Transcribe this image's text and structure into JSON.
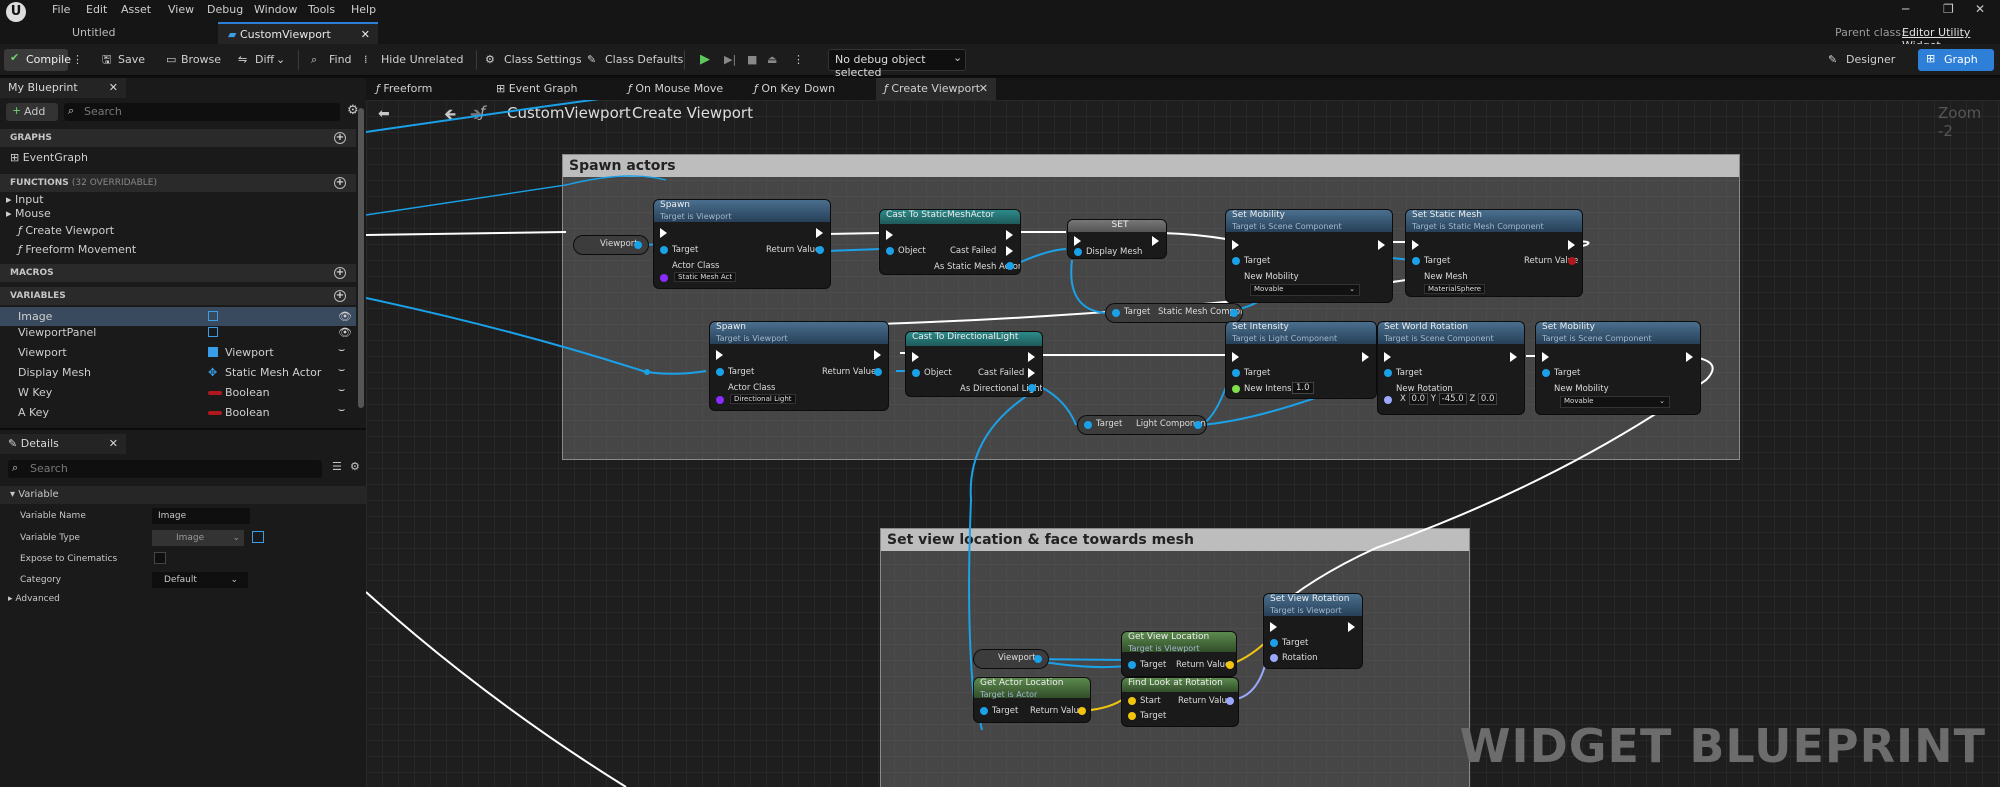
{
  "menubar": {
    "items": [
      "File",
      "Edit",
      "Asset",
      "View",
      "Debug",
      "Window",
      "Tools",
      "Help"
    ]
  },
  "doc_tabs": {
    "untitled": "Untitled",
    "custom": "CustomViewport"
  },
  "parent_class": {
    "label": "Parent class:",
    "value": "Editor Utility Widget"
  },
  "toolbar": {
    "compile": "Compile",
    "save": "Save",
    "browse": "Browse",
    "diff": "Diff",
    "find": "Find",
    "hide_unrelated": "Hide Unrelated",
    "class_settings": "Class Settings",
    "class_defaults": "Class Defaults",
    "debug_object": "No debug object selected",
    "designer": "Designer",
    "graph": "Graph"
  },
  "my_blueprint": {
    "tab": "My Blueprint",
    "add": "Add",
    "search_placeholder": "Search",
    "graphs_header": "GRAPHS",
    "event_graph": "EventGraph",
    "functions_header": "FUNCTIONS",
    "functions_count": "(32 OVERRIDABLE)",
    "functions": [
      "Input",
      "Mouse",
      "Create Viewport",
      "Freeform Movement"
    ],
    "macros_header": "MACROS",
    "variables_header": "VARIABLES",
    "variables": [
      {
        "name": "Image",
        "type": ""
      },
      {
        "name": "ViewportPanel",
        "type": ""
      },
      {
        "name": "Viewport",
        "type": "Viewport"
      },
      {
        "name": "Display Mesh",
        "type": "Static Mesh Actor"
      },
      {
        "name": "W Key",
        "type": "Boolean"
      },
      {
        "name": "A Key",
        "type": "Boolean"
      }
    ]
  },
  "details": {
    "tab": "Details",
    "search_placeholder": "Search",
    "section": "Variable",
    "var_name_label": "Variable Name",
    "var_name": "Image",
    "var_type_label": "Variable Type",
    "var_type": "Image",
    "expose_label": "Expose to Cinematics",
    "category_label": "Category",
    "category": "Default",
    "advanced": "Advanced"
  },
  "graph_tabs": [
    "Freeform Move...",
    "Event Graph",
    "On Mouse Move",
    "On Key Down",
    "Create Viewport"
  ],
  "breadcrumb": {
    "root": "CustomViewport",
    "current": "Create Viewport"
  },
  "zoom": "Zoom -2",
  "comments": {
    "spawn": "Spawn actors",
    "view": "Set view location & face towards mesh"
  },
  "nodes": {
    "viewport1": "Viewport",
    "viewport2": "Viewport",
    "spawn1": {
      "title": "Spawn",
      "sub": "Target is Viewport",
      "target": "Target",
      "actor_class": "Actor Class",
      "actor_class_value": "Static Mesh Act",
      "ret": "Return Value"
    },
    "cast_sm": {
      "title": "Cast To StaticMeshActor",
      "object": "Object",
      "failed": "Cast Failed",
      "as": "As Static Mesh Actor"
    },
    "set": {
      "title": "SET",
      "pin": "Display Mesh"
    },
    "setmob1": {
      "title": "Set Mobility",
      "sub": "Target is Scene Component",
      "target": "Target",
      "new": "New Mobility",
      "value": "Movable"
    },
    "setmesh": {
      "title": "Set Static Mesh",
      "sub": "Target is Static Mesh Component",
      "target": "Target",
      "new": "New Mesh",
      "value": "MaterialSphere",
      "ret": "Return Value"
    },
    "smcomp": {
      "target": "Target",
      "label": "Static Mesh Component"
    },
    "spawn2": {
      "title": "Spawn",
      "sub": "Target is Viewport",
      "target": "Target",
      "actor_class": "Actor Class",
      "actor_class_value": "Directional Light",
      "ret": "Return Value"
    },
    "cast_dl": {
      "title": "Cast To DirectionalLight",
      "object": "Object",
      "failed": "Cast Failed",
      "as": "As Directional Light"
    },
    "setint": {
      "title": "Set Intensity",
      "sub": "Target is Light Component",
      "target": "Target",
      "new": "New Intensity",
      "value": "1.0"
    },
    "setrot": {
      "title": "Set World Rotation",
      "sub": "Target is Scene Component",
      "target": "Target",
      "new": "New Rotation",
      "x": "0.0",
      "y": "-45.0",
      "z": "0.0"
    },
    "setmob2": {
      "title": "Set Mobility",
      "sub": "Target is Scene Component",
      "target": "Target",
      "new": "New Mobility",
      "value": "Movable"
    },
    "lightcomp": {
      "target": "Target",
      "label": "Light Component"
    },
    "getviewloc": {
      "title": "Get View Location",
      "sub": "Target is Viewport",
      "target": "Target",
      "ret": "Return Value"
    },
    "setviewrot": {
      "title": "Set View Rotation",
      "sub": "Target is Viewport",
      "target": "Target",
      "rotation": "Rotation"
    },
    "getactorloc": {
      "title": "Get Actor Location",
      "sub": "Target is Actor",
      "target": "Target",
      "ret": "Return Value"
    },
    "lookat": {
      "title": "Find Look at Rotation",
      "start": "Start",
      "target": "Target",
      "ret": "Return Value"
    }
  },
  "watermark": "WIDGET BLUEPRINT",
  "colors": {
    "accent": "#2d7fd8",
    "object_pin": "#1aa1e8",
    "vector_pin": "#f2c40e",
    "rotator_pin": "#9aa8ff",
    "exec": "#ffffff"
  }
}
